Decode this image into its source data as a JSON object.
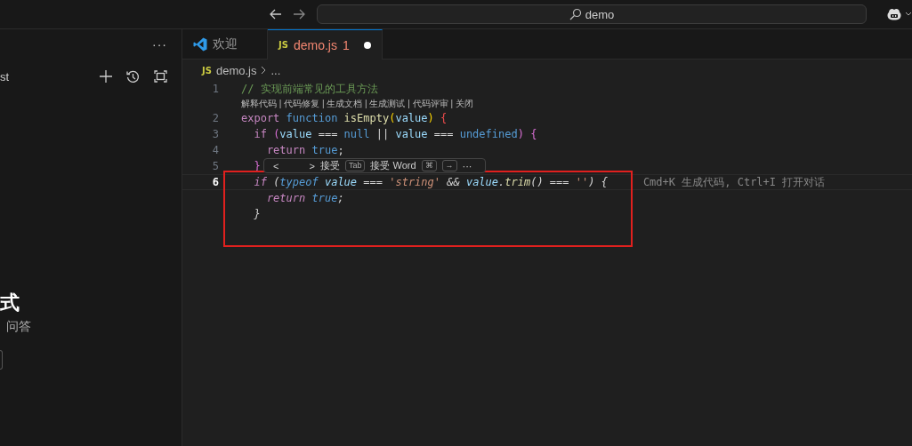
{
  "title_bar": {
    "search": "demo"
  },
  "sidebar": {
    "more": "···",
    "cut_label": "st",
    "heading": "式",
    "subtitle": "问答"
  },
  "tabs": [
    {
      "kind": "welcome",
      "label": "欢迎",
      "selected": false,
      "modified": false
    },
    {
      "kind": "file",
      "badge": "JS",
      "label": "demo.js",
      "selected": true,
      "problems": "1",
      "modified": true
    }
  ],
  "breadcrumb": {
    "badge": "JS",
    "file": "demo.js",
    "more": "..."
  },
  "code_lens": "解释代码 | 代码修复 | 生成文档 | 生成测试 | 代码评审 | 关闭",
  "lines": [
    {
      "number": "1",
      "active": false,
      "ghost": false,
      "tokens": [
        {
          "kind": "comment",
          "text": "// 实现前端常见的工具方法"
        }
      ]
    },
    {
      "number": "2",
      "active": false,
      "ghost": false,
      "tokens": [
        {
          "kind": "keyword",
          "text": "export "
        },
        {
          "kind": "storage",
          "text": "function "
        },
        {
          "kind": "func",
          "text": "isEmpty"
        },
        {
          "kind": "paren",
          "text": "("
        },
        {
          "kind": "var",
          "text": "value"
        },
        {
          "kind": "paren",
          "text": ") "
        },
        {
          "kind": "brace",
          "text": "{"
        }
      ]
    },
    {
      "number": "3",
      "active": false,
      "ghost": false,
      "tokens": [
        {
          "kind": "keyword",
          "text": "  if "
        },
        {
          "kind": "bracket",
          "text": "("
        },
        {
          "kind": "var",
          "text": "value"
        },
        {
          "kind": "plain",
          "text": " === "
        },
        {
          "kind": "storage",
          "text": "null"
        },
        {
          "kind": "plain",
          "text": " || "
        },
        {
          "kind": "var",
          "text": "value"
        },
        {
          "kind": "plain",
          "text": " === "
        },
        {
          "kind": "storage",
          "text": "undefined"
        },
        {
          "kind": "bracket",
          "text": ") {"
        }
      ]
    },
    {
      "number": "4",
      "active": false,
      "ghost": false,
      "tokens": [
        {
          "kind": "keyword",
          "text": "    return "
        },
        {
          "kind": "storage",
          "text": "true"
        },
        {
          "kind": "plain",
          "text": ";"
        }
      ]
    },
    {
      "number": "5",
      "active": false,
      "ghost": false,
      "tokens": [
        {
          "kind": "bracket",
          "text": "  }"
        }
      ]
    },
    {
      "number": "6",
      "active": true,
      "ghost": true,
      "hint": "Cmd+K 生成代码, Ctrl+I 打开对话",
      "tokens": [
        {
          "kind": "keyword",
          "text": "  if"
        },
        {
          "kind": "plain",
          "text": " ("
        },
        {
          "kind": "storage",
          "text": "typeof"
        },
        {
          "kind": "var",
          "text": " value"
        },
        {
          "kind": "plain",
          "text": " === "
        },
        {
          "kind": "string",
          "text": "'string'"
        },
        {
          "kind": "plain",
          "text": " && "
        },
        {
          "kind": "var",
          "text": "value"
        },
        {
          "kind": "plain",
          "text": "."
        },
        {
          "kind": "func",
          "text": "trim"
        },
        {
          "kind": "plain",
          "text": "() === "
        },
        {
          "kind": "string",
          "text": "''"
        },
        {
          "kind": "plain",
          "text": ") {"
        }
      ]
    },
    {
      "ghost": true,
      "tokens": [
        {
          "kind": "keyword",
          "text": "    return "
        },
        {
          "kind": "storage",
          "text": "true"
        },
        {
          "kind": "plain",
          "text": ";"
        }
      ]
    },
    {
      "ghost": true,
      "tokens": [
        {
          "kind": "plain",
          "text": "  }"
        }
      ]
    }
  ],
  "suggestion_widget": {
    "prev": "<",
    "next": ">",
    "accept": "接受",
    "accept_key": "Tab",
    "accept_word": "接受 Word",
    "word_keys": [
      "⌘",
      "→"
    ],
    "more": "···"
  }
}
